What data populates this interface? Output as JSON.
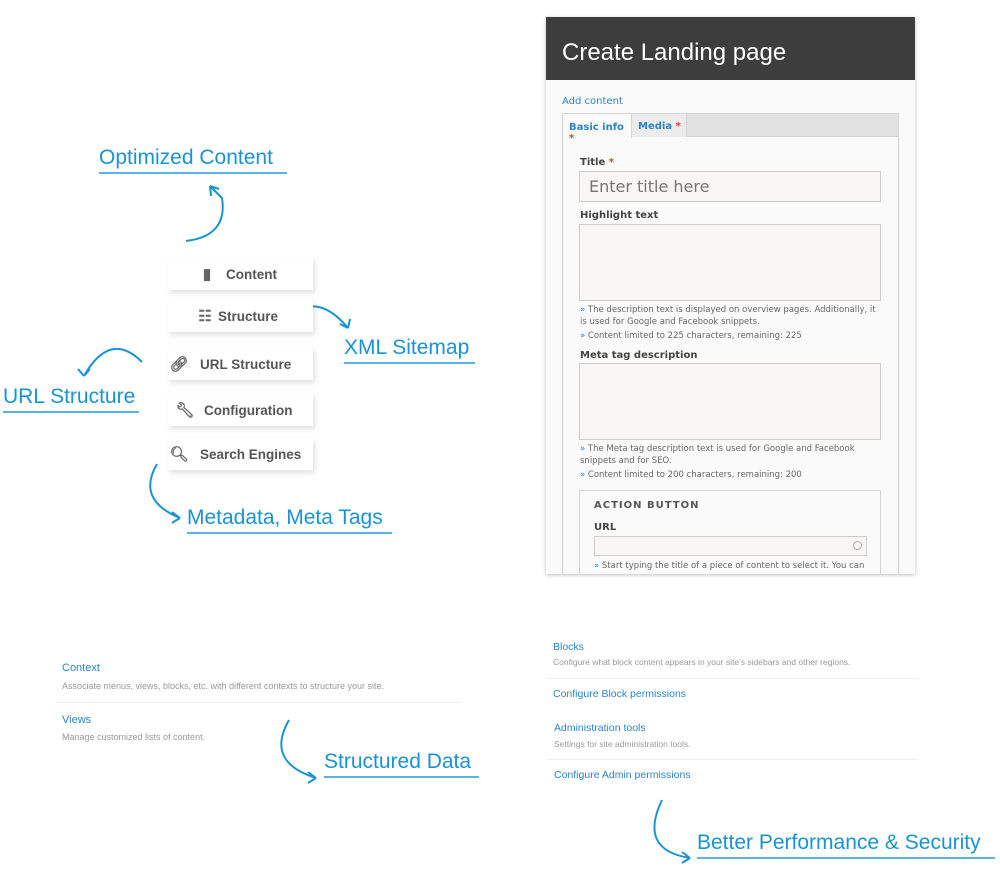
{
  "callouts": {
    "optimized": "Optimized Content",
    "xml": "XML Sitemap",
    "url": "URL Structure",
    "metadata": "Metadata, Meta Tags",
    "structured": "Structured Data",
    "performance": "Better Performance & Security"
  },
  "menu": [
    {
      "label": "Content",
      "icon": "document-icon"
    },
    {
      "label": "Structure",
      "icon": "sitemap-icon"
    },
    {
      "label": "URL Structure",
      "icon": "link-icon"
    },
    {
      "label": "Configuration",
      "icon": "wrench-icon"
    },
    {
      "label": "Search Engines",
      "icon": "search-icon"
    }
  ],
  "form": {
    "title": "Create Landing page",
    "breadcrumb": "Add content",
    "tabs": [
      {
        "label": "Basic info"
      },
      {
        "label": "Media"
      }
    ],
    "required_mark": "*",
    "title_label": "Title",
    "title_placeholder": "Enter title here",
    "highlight_label": "Highlight text",
    "highlight_help": "The description text is displayed on overview pages. Additionally, it is used for Google and Facebook snippets.",
    "highlight_limit": "Content limited to 225 characters, remaining: 225",
    "meta_label": "Meta tag description",
    "meta_help": "The Meta tag description text is used for Google and Facebook snippets and for SEO.",
    "meta_limit": "Content limited to 200 characters, remaining: 200",
    "action_legend": "ACTION BUTTON",
    "url_label": "URL",
    "url_help": "Start typing the title of a piece of content to select it. You can",
    "bullet": "»"
  },
  "left_list": [
    {
      "title": "Context",
      "desc": "Associate menus, views, blocks, etc. with different contexts to structure your site."
    },
    {
      "title": "Views",
      "desc": "Manage customized lists of content."
    }
  ],
  "right_list": [
    {
      "title": "Blocks",
      "desc": "Configure what block content appears in your site's sidebars and other regions."
    },
    {
      "title": "Configure Block permissions"
    },
    {
      "title": "Administration tools",
      "desc": "Settings for site administration tools."
    },
    {
      "title": "Configure Admin permissions"
    }
  ],
  "colors": {
    "accent": "#1a93d3",
    "header": "#3d3d3d",
    "link": "#2a85c8"
  }
}
